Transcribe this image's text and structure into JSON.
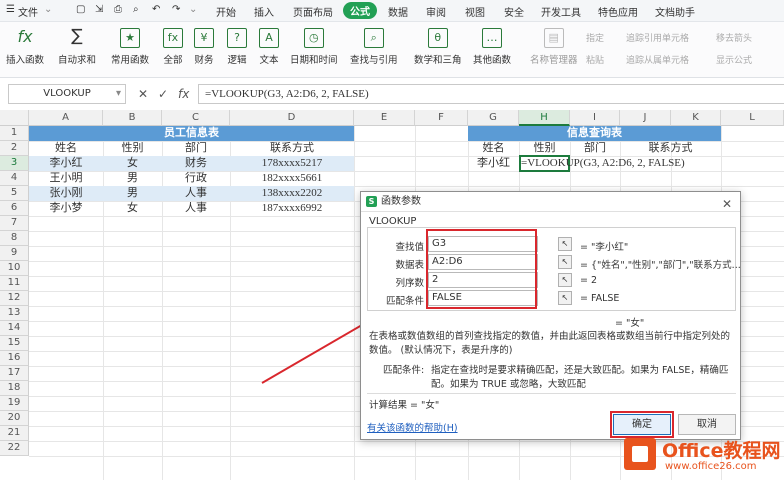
{
  "menubar": {
    "file": "文件",
    "tabs": [
      "开始",
      "插入",
      "页面布局",
      "公式",
      "数据",
      "审阅",
      "视图",
      "安全",
      "开发工具",
      "特色应用",
      "文档助手"
    ],
    "active_tab": "公式"
  },
  "ribbon": {
    "buttons": [
      "插入函数",
      "自动求和",
      "常用函数",
      "全部",
      "财务",
      "逻辑",
      "文本",
      "日期和时间",
      "查找与引用",
      "数学和三角",
      "其他函数",
      "名称管理器"
    ],
    "small": [
      "指定",
      "粘贴",
      "追踪引用单元格",
      "追踪从属单元格",
      "移去箭头",
      "显示公式"
    ]
  },
  "formula_bar": {
    "name_box": "VLOOKUP",
    "formula": "=VLOOKUP(G3, A2:D6, 2, FALSE)"
  },
  "sheet": {
    "columns": [
      "A",
      "B",
      "C",
      "D",
      "E",
      "F",
      "G",
      "H",
      "I",
      "J",
      "K",
      "L"
    ],
    "rows": [
      "1",
      "2",
      "3",
      "4",
      "5",
      "6",
      "7",
      "8",
      "9",
      "10",
      "11",
      "12",
      "13",
      "14",
      "15",
      "16",
      "17",
      "18",
      "19",
      "20",
      "21",
      "22"
    ],
    "table1_title": "员工信息表",
    "table1_headers": [
      "姓名",
      "性别",
      "部门",
      "联系方式"
    ],
    "table1_rows": [
      [
        "李小红",
        "女",
        "财务",
        "178xxxx5217"
      ],
      [
        "王小明",
        "男",
        "行政",
        "182xxxx5661"
      ],
      [
        "张小刚",
        "男",
        "人事",
        "138xxxx2202"
      ],
      [
        "李小梦",
        "女",
        "人事",
        "187xxxx6992"
      ]
    ],
    "table2_title": "信息查询表",
    "table2_headers": [
      "姓名",
      "性别",
      "部门",
      "联系方式"
    ],
    "query_name": "李小红",
    "active_cell_text": "=VLOOKUP(G3, A2:D6, 2, FALSE)"
  },
  "dialog": {
    "title": "函数参数",
    "function_name": "VLOOKUP",
    "args": [
      {
        "label": "查找值",
        "value": "G3",
        "result": "= \"李小红\""
      },
      {
        "label": "数据表",
        "value": "A2:D6",
        "result": "= {\"姓名\",\"性别\",\"部门\",\"联系方式..."
      },
      {
        "label": "列序数",
        "value": "2",
        "result": "= 2"
      },
      {
        "label": "匹配条件",
        "value": "FALSE",
        "result": "= FALSE"
      }
    ],
    "overall_result": "= \"女\"",
    "description_1": "在表格或数值数组的首列查找指定的数值，并由此返回表格或数组当前行中指定列处的",
    "description_2": "数值。 (默认情况下，表是升序的)",
    "arg_desc_label": "匹配条件:",
    "arg_desc_1": "指定在查找时是要求精确匹配，还是大致匹配。如果为 FALSE，精确匹",
    "arg_desc_2": "配。如果为 TRUE 或忽略，大致匹配",
    "calc_result": "计算结果 = \"女\"",
    "help_link": "有关该函数的帮助(H)",
    "ok": "确定",
    "cancel": "取消"
  },
  "watermark": {
    "line1": "Office教程网",
    "line2": "www.office26.com"
  },
  "colors": {
    "accent_green": "#22a055",
    "table_header": "#5b9bd5",
    "table_band": "#deebf7",
    "highlight_red": "#d9272d",
    "brand_orange": "#e8531d"
  }
}
